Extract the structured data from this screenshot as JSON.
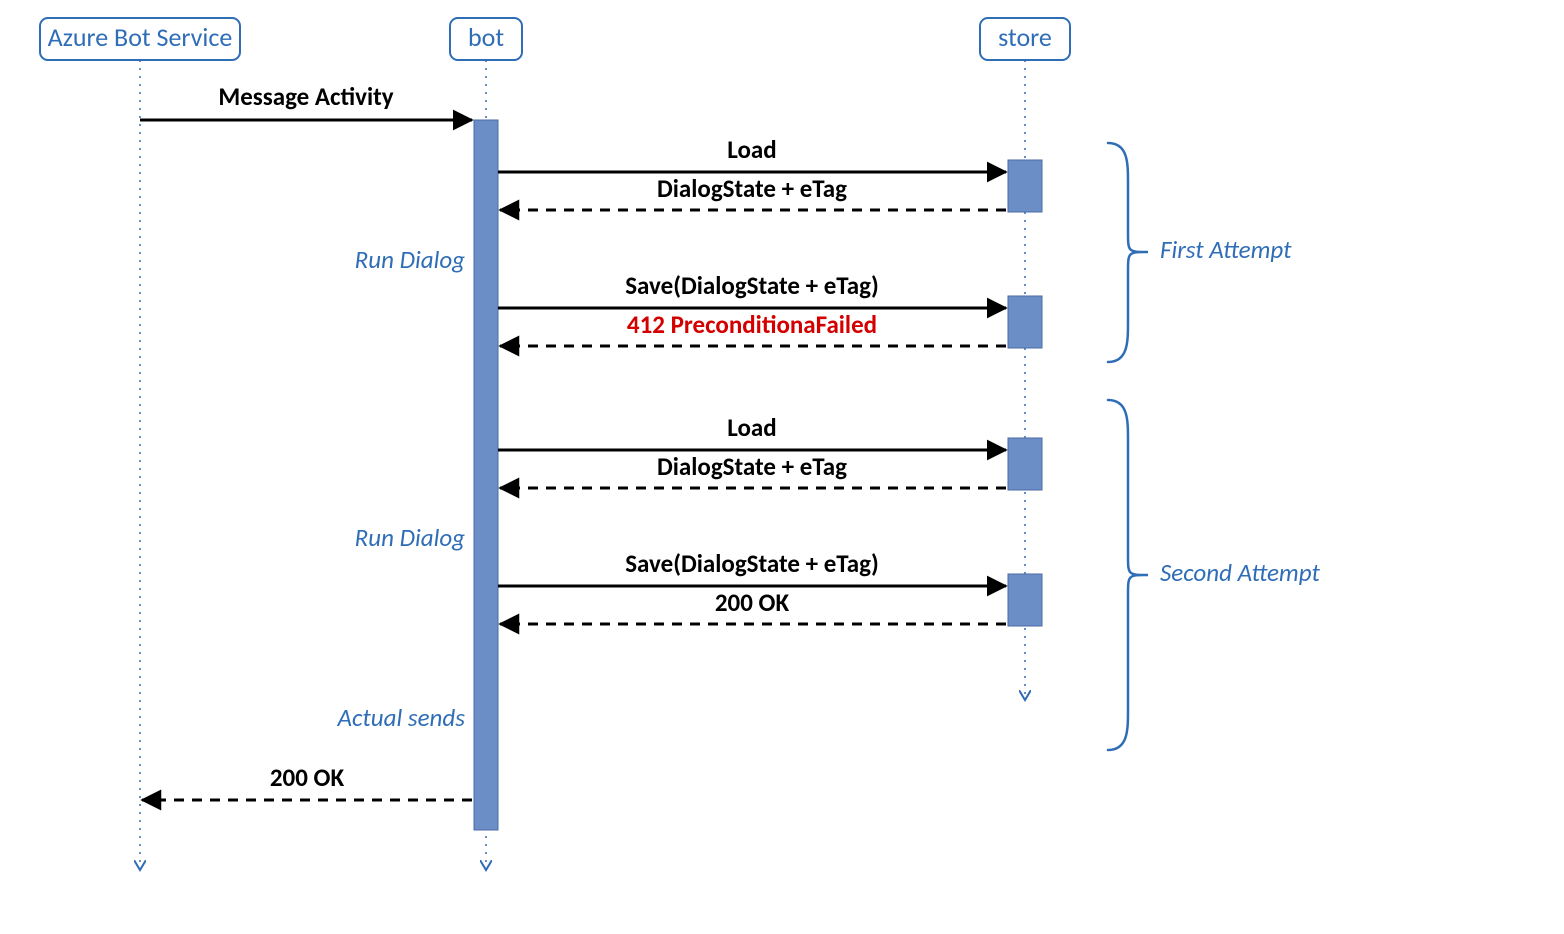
{
  "participants": {
    "azure": "Azure Bot Service",
    "bot": "bot",
    "store": "store"
  },
  "messages": {
    "msg_activity": "Message Activity",
    "load": "Load",
    "dialogstate_etag": "DialogState + eTag",
    "save_dialogstate_etag": "Save(DialogState + eTag)",
    "precondition_failed": "412 PreconditionaFailed",
    "ok200": "200 OK"
  },
  "notes": {
    "run_dialog": "Run Dialog",
    "actual_sends": "Actual sends"
  },
  "braces": {
    "first": "First Attempt",
    "second": "Second Attempt"
  }
}
